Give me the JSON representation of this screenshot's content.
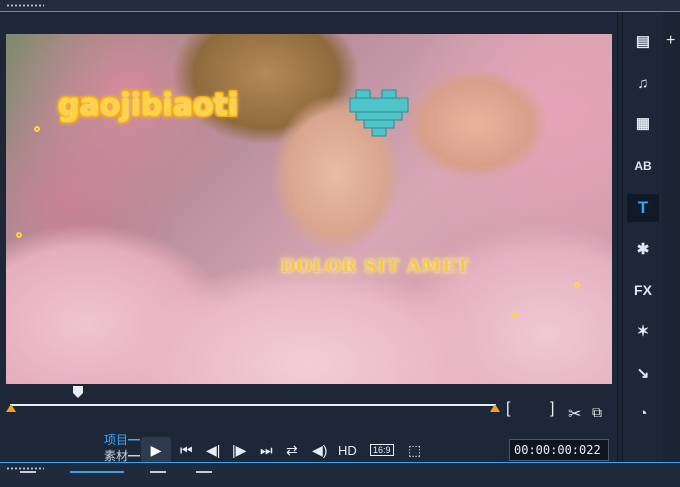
{
  "preview": {
    "overlay_title": "gaojibiaoti",
    "overlay_subtitle": "DOLOR SIT AMET"
  },
  "controls": {
    "mode_project": "项目",
    "mode_clip": "素材",
    "hd_label": "HD",
    "aspect_label": "16:9",
    "timecode": "00:00:00:022"
  },
  "icons": {
    "play": "play-icon",
    "prev": "skip-back-icon",
    "frame_back": "frame-back-icon",
    "frame_fwd": "frame-forward-icon",
    "next": "skip-forward-icon",
    "repeat": "repeat-icon",
    "volume": "volume-icon",
    "cut": "scissors-icon",
    "snapshot": "copy-icon"
  },
  "sidebar": {
    "items": [
      {
        "name": "media-icon",
        "glyph": "▤"
      },
      {
        "name": "music-icon",
        "glyph": "♫"
      },
      {
        "name": "instant-project-icon",
        "glyph": "▦"
      },
      {
        "name": "transition-icon",
        "glyph": "AB"
      },
      {
        "name": "title-icon",
        "glyph": "T"
      },
      {
        "name": "graphics-icon",
        "glyph": "✱"
      },
      {
        "name": "fx-icon",
        "glyph": "FX"
      },
      {
        "name": "magic-wand-icon",
        "glyph": "✶"
      },
      {
        "name": "path-icon",
        "glyph": "↘"
      },
      {
        "name": "speed-gauge-icon",
        "glyph": "◔"
      }
    ],
    "active_index": 4
  },
  "colors": {
    "accent": "#2ea7ff",
    "title_gold": "#fcd34a",
    "handle_orange": "#f5a01a"
  }
}
